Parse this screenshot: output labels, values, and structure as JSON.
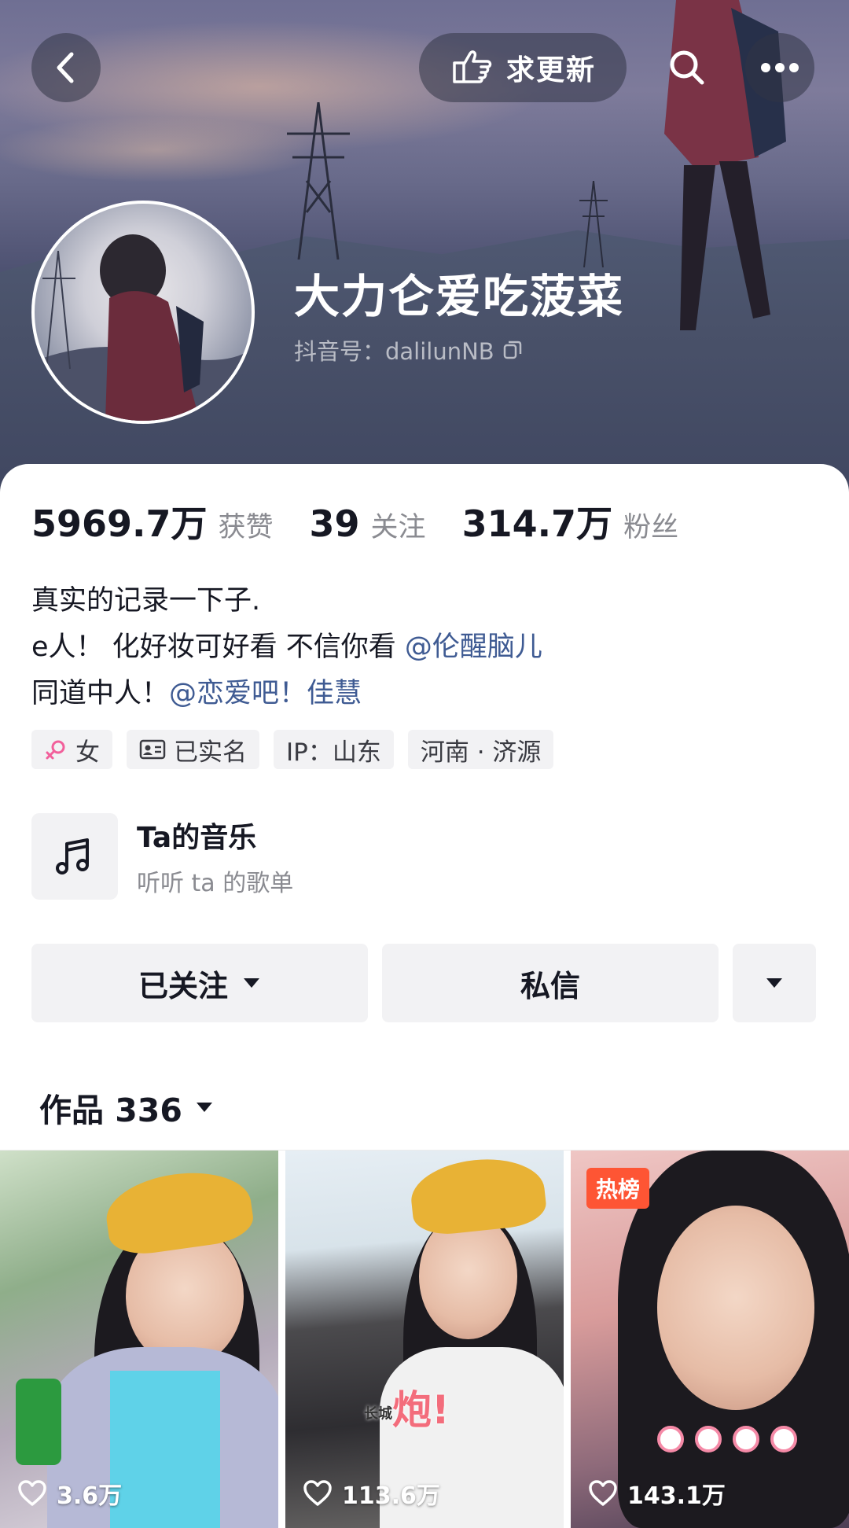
{
  "header": {
    "update_label": "求更新"
  },
  "profile": {
    "nickname": "大力仑爱吃菠菜",
    "douyin_id": "抖音号：dalilunNB"
  },
  "stats": [
    {
      "value": "5969.7万",
      "label": "获赞"
    },
    {
      "value": "39",
      "label": "关注"
    },
    {
      "value": "314.7万",
      "label": "粉丝"
    }
  ],
  "bio": {
    "line1": "真实的记录一下子.",
    "line2_text": "e人！ 化好妆可好看 不信你看 ",
    "line2_mention": "@伦醒脑儿",
    "line3_text": "同道中人！",
    "line3_mention": "@恋爱吧！佳慧"
  },
  "tags": {
    "gender": "女",
    "verified": "已实名",
    "ip": "IP：山东",
    "location": "河南 · 济源"
  },
  "music": {
    "title": "Ta的音乐",
    "subtitle": "听听 ta 的歌单"
  },
  "actions": {
    "follow_label": "已关注",
    "message_label": "私信"
  },
  "works": {
    "label": "作品 336"
  },
  "videos": [
    {
      "likes": "3.6万"
    },
    {
      "likes": "113.6万",
      "caption": "炮!",
      "caption_small": "长城"
    },
    {
      "likes": "143.1万",
      "badge": "热榜"
    }
  ],
  "colors": {
    "mention": "#3f5b93",
    "hot_badge": "#fe5534",
    "button_bg": "#f2f2f4"
  }
}
